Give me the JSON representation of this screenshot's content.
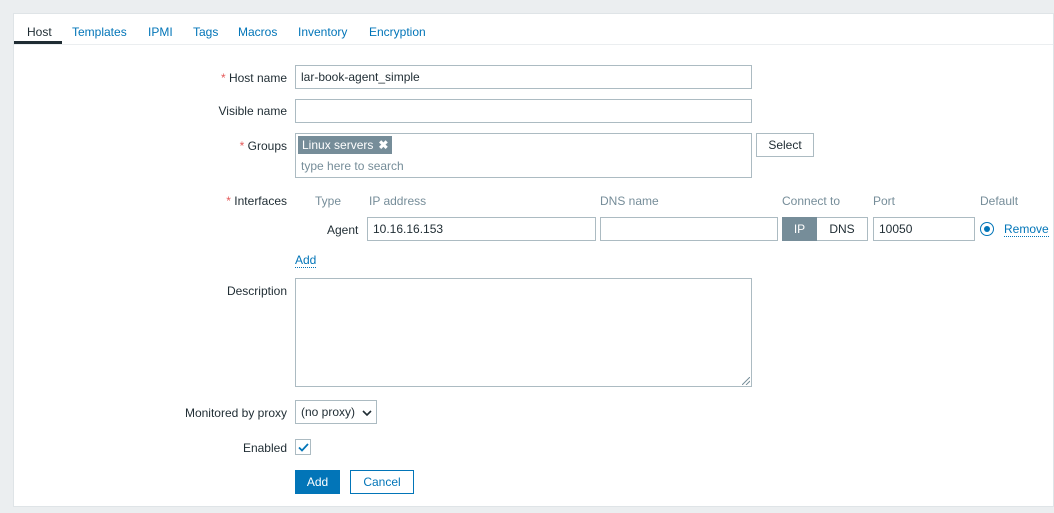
{
  "tabs": [
    {
      "label": "Host",
      "active": true
    },
    {
      "label": "Templates"
    },
    {
      "label": "IPMI"
    },
    {
      "label": "Tags"
    },
    {
      "label": "Macros"
    },
    {
      "label": "Inventory"
    },
    {
      "label": "Encryption"
    }
  ],
  "form": {
    "required_mark": "*",
    "host_name": {
      "label": "Host name",
      "value": "lar-book-agent_simple"
    },
    "visible_name": {
      "label": "Visible name",
      "value": ""
    },
    "groups": {
      "label": "Groups",
      "selected": "Linux servers",
      "remove_glyph": "✖",
      "placeholder": "type here to search",
      "select_button": "Select"
    },
    "interfaces": {
      "label": "Interfaces",
      "headers": {
        "type": "Type",
        "ip": "IP address",
        "dns": "DNS name",
        "connect": "Connect to",
        "port": "Port",
        "default": "Default"
      },
      "rows": [
        {
          "type": "Agent",
          "ip": "10.16.16.153",
          "dns": "",
          "connect_ip": "IP",
          "connect_dns": "DNS",
          "port": "10050",
          "remove": "Remove"
        }
      ],
      "add_link": "Add"
    },
    "description": {
      "label": "Description",
      "value": ""
    },
    "proxy": {
      "label": "Monitored by proxy",
      "value": "(no proxy)"
    },
    "enabled": {
      "label": "Enabled",
      "checked": true
    },
    "buttons": {
      "add": "Add",
      "cancel": "Cancel"
    }
  },
  "colors": {
    "accent": "#0275b8",
    "required": "#e45959",
    "tag_bg": "#768d99",
    "page_bg": "#ebeef0"
  },
  "icons": [
    "remove-tag-icon",
    "dropdown-chevron-icon",
    "checkmark-icon",
    "resize-grip-icon"
  ]
}
